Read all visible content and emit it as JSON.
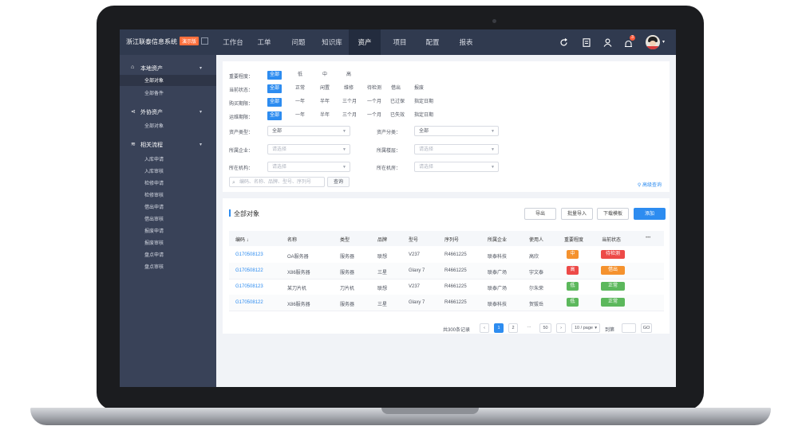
{
  "app": {
    "name": "浙江联泰信息系统",
    "badge": "演示版"
  },
  "nav": [
    "工作台",
    "工单",
    "问题",
    "知识库",
    "资产",
    "项目",
    "配置",
    "报表"
  ],
  "nav_active": "资产",
  "header_icons": [
    "refresh-icon",
    "document-icon",
    "user-icon",
    "bell-icon",
    "avatar"
  ],
  "notifications": "3",
  "sidebar": {
    "groups": [
      {
        "label": "本地资产",
        "icon": "home-icon"
      },
      {
        "label": "外协资产",
        "icon": "share-icon"
      },
      {
        "label": "相关流程",
        "icon": "layers-icon"
      }
    ],
    "local_items": [
      "全部对象",
      "全部备件"
    ],
    "external_items": [
      "全部对象"
    ],
    "process_items": [
      "入库申请",
      "入库审核",
      "检修申请",
      "检修审核",
      "借出申请",
      "借出审核",
      "报废申请",
      "报废审核",
      "盘点申请",
      "盘点审核"
    ]
  },
  "filters": {
    "importance": {
      "label": "重要程度：",
      "options": [
        "全部",
        "低",
        "中",
        "高"
      ]
    },
    "status": {
      "label": "当前状态：",
      "options": [
        "全部",
        "正常",
        "闲置",
        "维修",
        "待检测",
        "借出",
        "报废"
      ]
    },
    "purchase_date": {
      "label": "购买期限：",
      "options": [
        "全部",
        "一年",
        "半年",
        "三个月",
        "一个月",
        "已过保",
        "指定日期"
      ]
    },
    "warranty_date": {
      "label": "运维期限：",
      "options": [
        "全部",
        "一年",
        "半年",
        "三个月",
        "一个月",
        "已失效",
        "指定日期"
      ]
    },
    "asset_type": {
      "label": "资产类型：",
      "value": "全部"
    },
    "asset_category": {
      "label": "资产分类：",
      "value": "全部"
    },
    "company": {
      "label": "所属企业：",
      "placeholder": "请选择"
    },
    "location": {
      "label": "所属楼层：",
      "placeholder": "请选择"
    },
    "org": {
      "label": "所在机构：",
      "placeholder": "请选择"
    },
    "room": {
      "label": "所在机房：",
      "placeholder": "请选择"
    },
    "search_placeholder": "编码、名称、品牌、型号、序列号",
    "search_button": "查询",
    "advanced": "高级查询"
  },
  "list": {
    "title": "全部对象",
    "buttons": {
      "export": "导出",
      "import": "批量导入",
      "template": "下载模板",
      "add": "添加"
    },
    "columns": [
      "编码 ↓",
      "名称",
      "类型",
      "品牌",
      "型号",
      "序列号",
      "所属企业",
      "使用人",
      "重要程度",
      "当前状态"
    ],
    "more": "•••",
    "rows": [
      {
        "code": "G170508123",
        "name": "OA服务器",
        "type": "服务器",
        "brand": "联想",
        "model": "V237",
        "serial": "R4661225",
        "company": "联泰科技",
        "user": "高欣",
        "importance": "中",
        "imp_color": "#f5922e",
        "status": "待检测",
        "st_color": "#ed4a48"
      },
      {
        "code": "G170508122",
        "name": "X86服务器",
        "type": "服务器",
        "brand": "三星",
        "model": "Glaxy 7",
        "serial": "R4661225",
        "company": "联泰广场",
        "user": "宇文泰",
        "importance": "高",
        "imp_color": "#ed4a48",
        "status": "借出",
        "st_color": "#f5922e"
      },
      {
        "code": "G170508123",
        "name": "某刀片机",
        "type": "刀片机",
        "brand": "联想",
        "model": "V237",
        "serial": "R4661225",
        "company": "联泰广场",
        "user": "尔朱荣",
        "importance": "低",
        "imp_color": "#5cb85c",
        "status": "正常",
        "st_color": "#5cb85c"
      },
      {
        "code": "G170508122",
        "name": "X86服务器",
        "type": "服务器",
        "brand": "三星",
        "model": "Glaxy 7",
        "serial": "R4661225",
        "company": "联泰科技",
        "user": "贺拔岳",
        "importance": "低",
        "imp_color": "#5cb85c",
        "status": "正常",
        "st_color": "#5cb85c"
      }
    ]
  },
  "pagination": {
    "total": "共300条记录",
    "prev": "‹",
    "pages": [
      "1",
      "2",
      "···",
      "50"
    ],
    "next": "›",
    "page_size": "10 / page",
    "goto": "到第",
    "go": "GO"
  }
}
